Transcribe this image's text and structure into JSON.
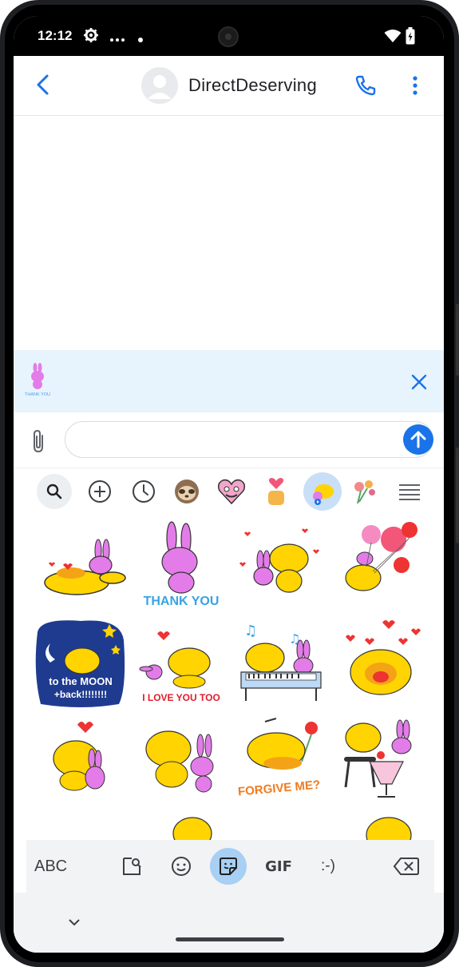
{
  "status_bar": {
    "time": "12:12",
    "icons": [
      "settings-gear-icon",
      "more-dots-icon",
      "notification-dot-icon",
      "wifi-icon",
      "battery-charging-icon"
    ]
  },
  "app_bar": {
    "title": "DirectDeserving",
    "icons": [
      "back-arrow-icon",
      "avatar-icon",
      "phone-call-icon",
      "more-vert-icon"
    ]
  },
  "sticker_preview": {
    "caption": "THANK YOU",
    "close_icon": "close-icon"
  },
  "compose": {
    "value": "",
    "placeholder": "",
    "attach_icon": "paperclip-icon",
    "send_icon": "send-arrow-icon"
  },
  "sticker_categories": [
    "search",
    "add",
    "recent",
    "sloth",
    "heart-face",
    "hand-heart",
    "cat-bunny (selected)",
    "flowers",
    "menu"
  ],
  "stickers": [
    {
      "name": "cat-bunny-lying",
      "caption": ""
    },
    {
      "name": "bunny-thank-you",
      "caption": "THANK YOU"
    },
    {
      "name": "cat-bunny-hearts",
      "caption": ""
    },
    {
      "name": "cat-balloons",
      "caption": ""
    },
    {
      "name": "to-the-moon",
      "caption_line1": "to the MOON",
      "caption_line2": "+back!!!!!!!!"
    },
    {
      "name": "i-love-you-too",
      "caption": "I LOVE YOU TOO"
    },
    {
      "name": "piano",
      "caption": ""
    },
    {
      "name": "cat-laugh-hearts",
      "caption": ""
    },
    {
      "name": "cat-hug-heart",
      "caption": ""
    },
    {
      "name": "cat-bunny-hug",
      "caption": ""
    },
    {
      "name": "forgive-me",
      "caption": "FORGIVE ME?"
    },
    {
      "name": "milkshake",
      "caption": ""
    }
  ],
  "keyboard_bar": {
    "abc": "ABC",
    "gif": "GIF",
    "emoticon": ":-)",
    "icons": [
      "sticker-search-icon",
      "emoji-icon",
      "sticker-icon",
      "gif-icon",
      "emoticon-icon",
      "backspace-icon"
    ]
  },
  "colors": {
    "accent": "#1a73e8",
    "preview_bg": "#e7f3fd",
    "active_tab": "#a8cff4",
    "cat_yellow": "#ffd400",
    "bunny_pink": "#e37ce8"
  }
}
